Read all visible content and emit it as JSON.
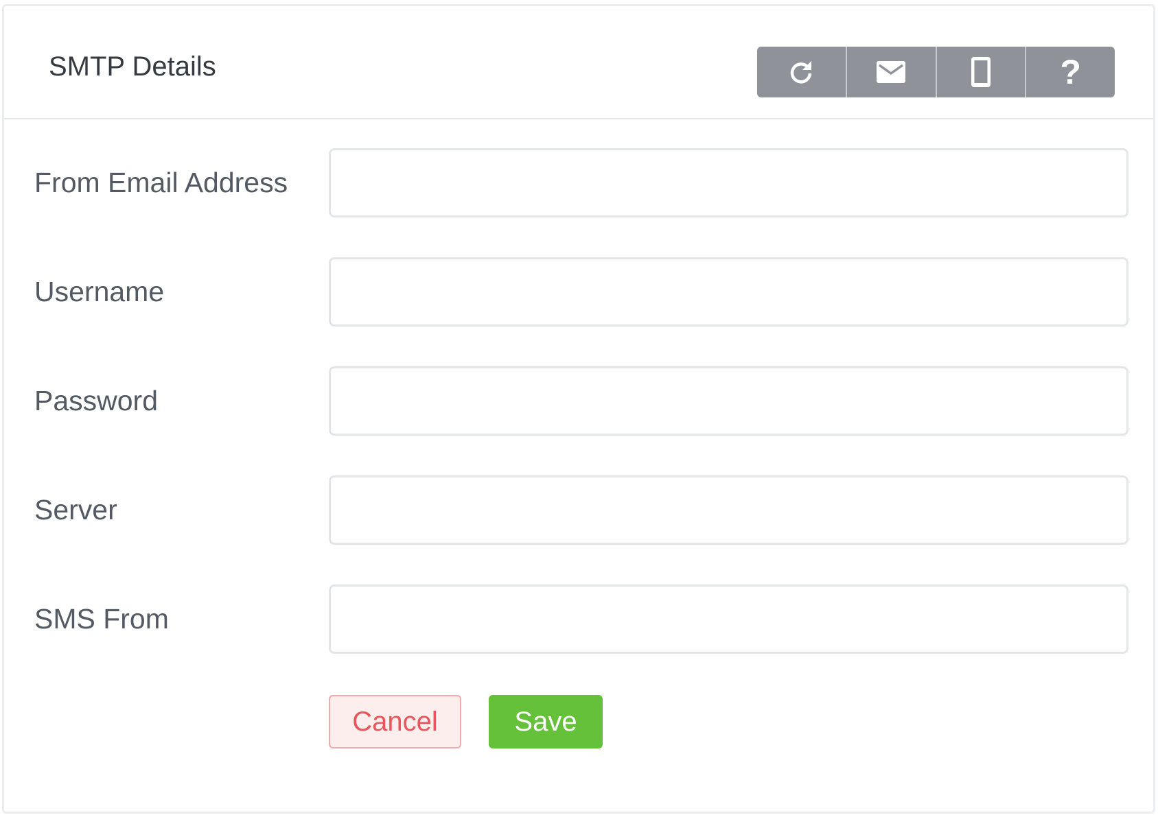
{
  "panel": {
    "title": "SMTP Details"
  },
  "toolbar": {
    "buttons": [
      {
        "icon": "refresh-icon"
      },
      {
        "icon": "envelope-icon"
      },
      {
        "icon": "mobile-icon"
      },
      {
        "icon": "question-icon",
        "glyph": "?"
      }
    ]
  },
  "form": {
    "fields": [
      {
        "label": "From Email Address",
        "value": "",
        "placeholder": ""
      },
      {
        "label": "Username",
        "value": "",
        "placeholder": ""
      },
      {
        "label": "Password",
        "value": "",
        "placeholder": ""
      },
      {
        "label": "Server",
        "value": "",
        "placeholder": ""
      },
      {
        "label": "SMS From",
        "value": "",
        "placeholder": ""
      }
    ]
  },
  "actions": {
    "cancel_label": "Cancel",
    "save_label": "Save"
  },
  "colors": {
    "toolbar_bg": "#8f9399",
    "save_bg": "#64c139",
    "cancel_text": "#e8555c",
    "cancel_bg": "#fdeeee"
  }
}
